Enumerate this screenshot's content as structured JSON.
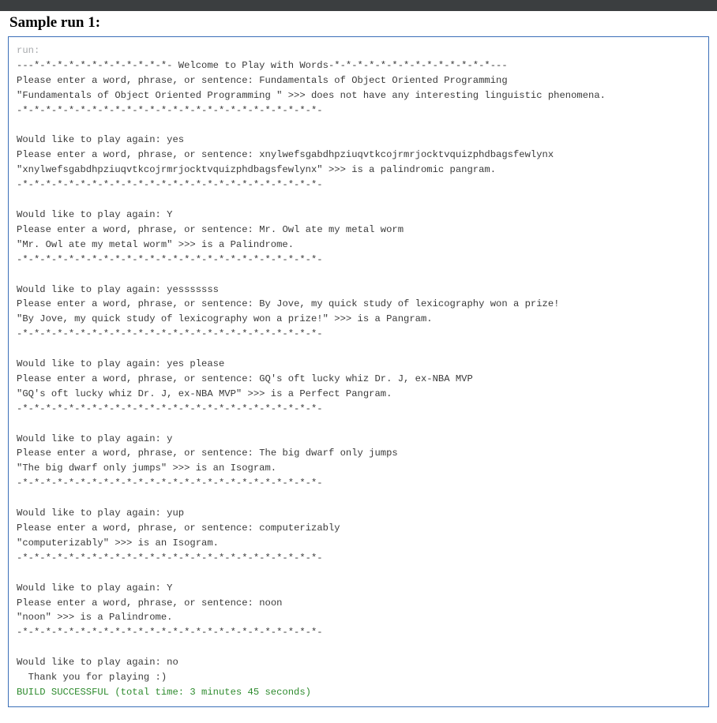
{
  "title": "Sample run 1:",
  "console": {
    "run_label": "run:",
    "welcome": "---*-*-*-*-*-*-*-*-*-*-*-*- Welcome to Play with Words-*-*-*-*-*-*-*-*-*-*-*-*-*-*---",
    "sep_long": "-*-*-*-*-*-*-*-*-*-*-*-*-*-*-*-*-*-*-*-*-*-*-*-*-*-*-",
    "prompts": {
      "enter": "Please enter a word, phrase, or sentence: ",
      "again": "Would like to play again: "
    },
    "runs": [
      {
        "input": "Fundamentals of Object Oriented Programming",
        "result": "\"Fundamentals of Object Oriented Programming \" >>> does not have any interesting linguistic phenomena."
      },
      {
        "again_answer": "yes",
        "input": "xnylwefsgabdhpziuqvtkcojrmrjocktvquizphdbagsfewlynx",
        "result": "\"xnylwefsgabdhpziuqvtkcojrmrjocktvquizphdbagsfewlynx\" >>> is a palindromic pangram."
      },
      {
        "again_answer": "Y",
        "input": "Mr. Owl ate my metal worm",
        "result": "\"Mr. Owl ate my metal worm\" >>> is a Palindrome."
      },
      {
        "again_answer": "yesssssss",
        "input": "By Jove, my quick study of lexicography won a prize!",
        "result": "\"By Jove, my quick study of lexicography won a prize!\" >>> is a Pangram."
      },
      {
        "again_answer": "yes please",
        "input": "GQ's oft lucky whiz Dr. J, ex-NBA MVP",
        "result": "\"GQ's oft lucky whiz Dr. J, ex-NBA MVP\" >>> is a Perfect Pangram."
      },
      {
        "again_answer": "y",
        "input": "The big dwarf only jumps",
        "result": "\"The big dwarf only jumps\" >>> is an Isogram."
      },
      {
        "again_answer": "yup",
        "input": "computerizably",
        "result": "\"computerizably\" >>> is an Isogram."
      },
      {
        "again_answer": "Y",
        "input": "noon",
        "result": "\"noon\" >>> is a Palindrome."
      }
    ],
    "final_again_answer": "no",
    "thanks": "  Thank you for playing :)",
    "build": "BUILD SUCCESSFUL (total time: 3 minutes 45 seconds)"
  }
}
